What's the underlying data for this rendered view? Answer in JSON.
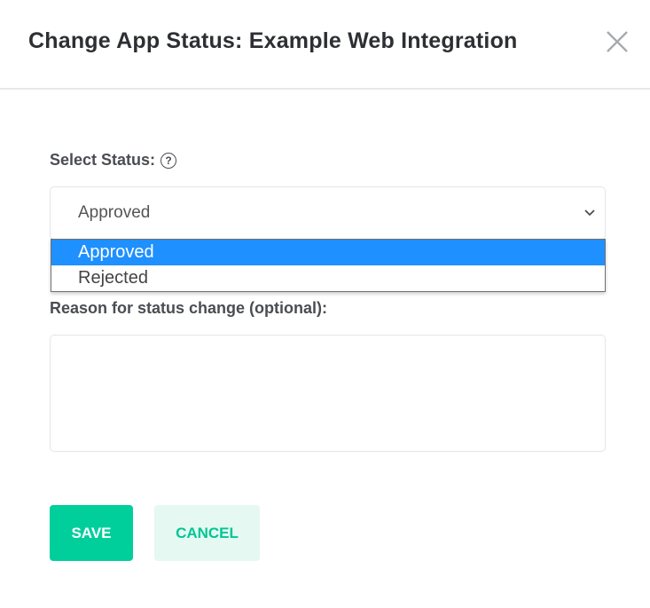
{
  "dialog": {
    "title": "Change App Status: Example Web Integration",
    "close_icon": "close-icon"
  },
  "status": {
    "label": "Select Status:",
    "help_icon": "?",
    "selected": "Approved",
    "options": [
      {
        "label": "Approved",
        "highlighted": true
      },
      {
        "label": "Rejected",
        "highlighted": false
      }
    ]
  },
  "reason": {
    "label": "Reason for status change (optional):",
    "value": ""
  },
  "buttons": {
    "save": "SAVE",
    "cancel": "CANCEL"
  },
  "colors": {
    "primary": "#00cf9c",
    "secondary_bg": "#e5f8f2",
    "highlight": "#1e90ff"
  }
}
